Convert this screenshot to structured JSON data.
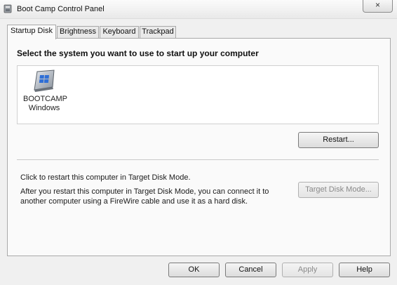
{
  "window": {
    "title": "Boot Camp Control Panel",
    "close_symbol": "×"
  },
  "tabs": [
    {
      "label": "Startup Disk",
      "active": true
    },
    {
      "label": "Brightness",
      "active": false
    },
    {
      "label": "Keyboard",
      "active": false
    },
    {
      "label": "Trackpad",
      "active": false
    }
  ],
  "startup": {
    "heading": "Select the system you want to use to start up your computer",
    "disks": [
      {
        "name": "BOOTCAMP",
        "os": "Windows",
        "icon": "windows-disk-icon"
      }
    ],
    "restart_label": "Restart..."
  },
  "target_disk": {
    "line1": "Click to restart this computer in Target Disk Mode.",
    "line2": "After you restart this computer in Target Disk Mode, you can connect it to another computer using a FireWire cable and use it as a hard disk.",
    "button_label": "Target Disk Mode...",
    "button_enabled": false
  },
  "footer": {
    "ok_label": "OK",
    "cancel_label": "Cancel",
    "apply_label": "Apply",
    "help_label": "Help"
  }
}
